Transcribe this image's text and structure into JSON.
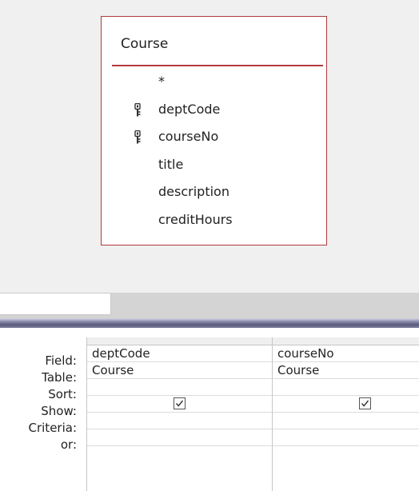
{
  "design_pane": {
    "table": {
      "title": "Course",
      "fields": [
        {
          "label": "*",
          "key": false
        },
        {
          "label": "deptCode",
          "key": true
        },
        {
          "label": "courseNo",
          "key": true
        },
        {
          "label": "title",
          "key": false
        },
        {
          "label": "description",
          "key": false
        },
        {
          "label": "creditHours",
          "key": false
        }
      ]
    }
  },
  "grid": {
    "row_labels": {
      "field": "Field:",
      "table": "Table:",
      "sort": "Sort:",
      "show": "Show:",
      "criteria": "Criteria:",
      "or": "or:"
    },
    "columns": [
      {
        "field": "deptCode",
        "table": "Course",
        "sort": "",
        "show": true,
        "criteria": "",
        "or": ""
      },
      {
        "field": "courseNo",
        "table": "Course",
        "sort": "",
        "show": true,
        "criteria": "",
        "or": ""
      }
    ]
  },
  "icons": {
    "key": "primary-key-icon",
    "check": "checkmark-icon"
  }
}
